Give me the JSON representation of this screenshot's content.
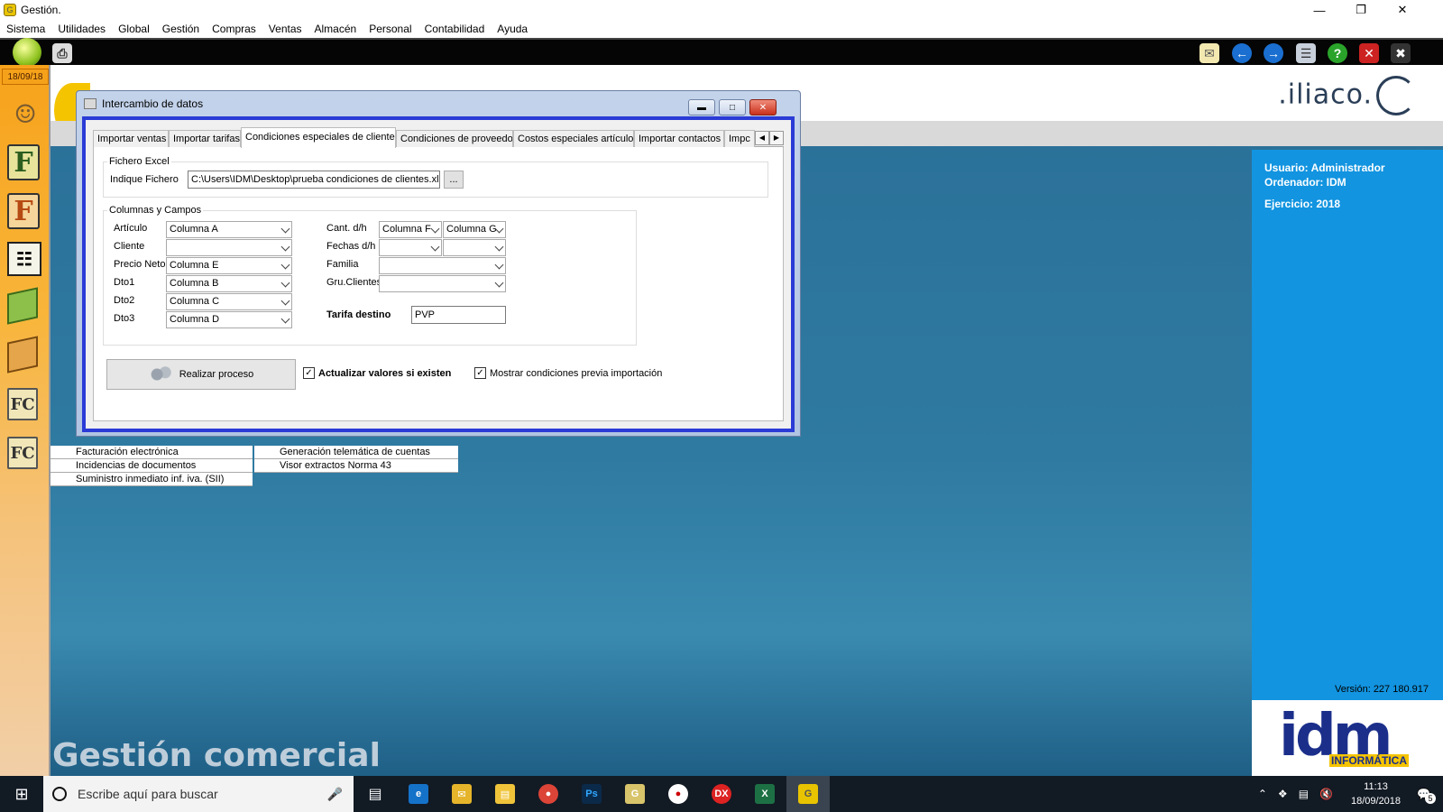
{
  "window": {
    "title": "Gestión."
  },
  "menubar": [
    "Sistema",
    "Utilidades",
    "Global",
    "Gestión",
    "Compras",
    "Ventas",
    "Almacén",
    "Personal",
    "Contabilidad",
    "Ayuda"
  ],
  "sidebar": {
    "date": "18/09/18"
  },
  "brand": {
    "iliaco": ".iliaco.",
    "gestion_title": "Gestión comercial",
    "idm": "idm",
    "idm_sub": "INFORMÁTICA"
  },
  "menu_list": {
    "left": [
      "Facturación electrónica",
      "Incidencias de documentos",
      "Suministro inmediato inf. iva. (SII)"
    ],
    "right": [
      "Generación telemática de cuentas",
      "Visor extractos Norma 43"
    ]
  },
  "info": {
    "usuario": "Usuario: Administrador",
    "ordenador": "Ordenador: IDM",
    "ejercicio": "Ejercicio: 2018",
    "version": "Versión: 227 180.917"
  },
  "dialog": {
    "title": "Intercambio de datos",
    "tabs": [
      "Importar ventas",
      "Importar tarifas",
      "Condiciones especiales de cliente",
      "Condiciones de proveedor",
      "Costos especiales artículo",
      "Importar contactos",
      "Impc"
    ],
    "active_tab": 2,
    "fichero": {
      "legend": "Fichero Excel",
      "label": "Indique Fichero",
      "value": "C:\\Users\\IDM\\Desktop\\prueba condiciones de clientes.xls",
      "browse": "..."
    },
    "columnas": {
      "legend": "Columnas y Campos",
      "articulo_lbl": "Artículo",
      "articulo_val": "Columna A",
      "cliente_lbl": "Cliente",
      "cliente_val": "",
      "precio_lbl": "Precio Neto",
      "precio_val": "Columna E",
      "dto1_lbl": "Dto1",
      "dto1_val": "Columna B",
      "dto2_lbl": "Dto2",
      "dto2_val": "Columna C",
      "dto3_lbl": "Dto3",
      "dto3_val": "Columna D",
      "cant_lbl": "Cant. d/h",
      "cant_val1": "Columna F",
      "cant_val2": "Columna G",
      "fechas_lbl": "Fechas d/h",
      "fechas_val1": "",
      "fechas_val2": "",
      "familia_lbl": "Familia",
      "familia_val": "",
      "gru_lbl": "Gru.Clientes",
      "gru_val": "",
      "tarifa_lbl": "Tarifa destino",
      "tarifa_val": "PVP"
    },
    "process_btn": "Realizar proceso",
    "chk_actualizar": "Actualizar valores si existen",
    "chk_mostrar": "Mostrar condiciones previa importación"
  },
  "taskbar": {
    "search_placeholder": "Escribe aquí para buscar",
    "time": "11:13",
    "date": "18/09/2018",
    "notif": "5"
  },
  "colors": {
    "toolbar": "#050505",
    "sidebar": "#f7a21b",
    "main_bg": "#2f7aa1",
    "info_blue": "#1294e0",
    "dialog_border": "#2a3bd6"
  }
}
